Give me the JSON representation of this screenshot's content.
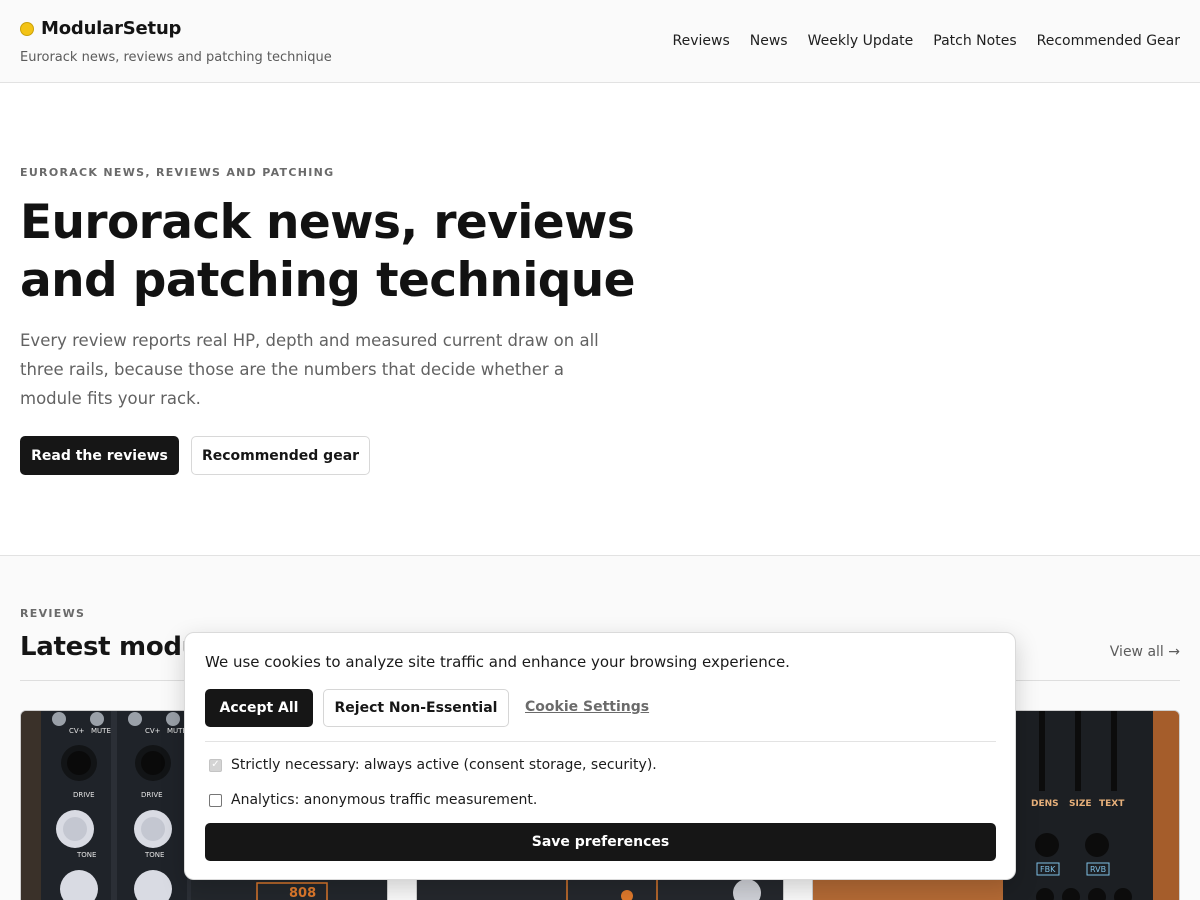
{
  "header": {
    "brand": "ModularSetup",
    "tagline": "Eurorack news, reviews and patching technique",
    "nav": [
      "Reviews",
      "News",
      "Weekly Update",
      "Patch Notes",
      "Recommended Gear"
    ]
  },
  "hero": {
    "eyebrow": "EURORACK NEWS, REVIEWS AND PATCHING",
    "title": "Eurorack news, reviews and patching technique",
    "lead": "Every review reports real HP, depth and measured current draw on all three rails, because those are the numbers that decide whether a module fits your rack.",
    "primary_cta": "Read the reviews",
    "secondary_cta": "Recommended gear"
  },
  "reviews": {
    "eyebrow": "REVIEWS",
    "title": "Latest module reviews",
    "view_all": "View all →",
    "cards": [
      {
        "panel_labels": [
          "CV+",
          "MUTE",
          "CV+",
          "MUTE",
          "DRIVE",
          "DRIVE",
          "TONE",
          "TONE",
          "808"
        ]
      },
      {
        "panel_labels": []
      },
      {
        "panel_labels": [
          "DENS",
          "SIZE",
          "TEXT",
          "FBK",
          "RVB"
        ]
      }
    ]
  },
  "cookie": {
    "message": "We use cookies to analyze site traffic and enhance your browsing experience.",
    "accept": "Accept All",
    "reject": "Reject Non-Essential",
    "settings": "Cookie Settings",
    "options": [
      {
        "label": "Strictly necessary: always active (consent storage, security).",
        "checked": true,
        "disabled": true
      },
      {
        "label": "Analytics: anonymous traffic measurement.",
        "checked": false,
        "disabled": false
      }
    ],
    "save": "Save preferences"
  },
  "colors": {
    "accent": "#f3c315",
    "primary": "#161616",
    "background_alt": "#fafafa"
  }
}
